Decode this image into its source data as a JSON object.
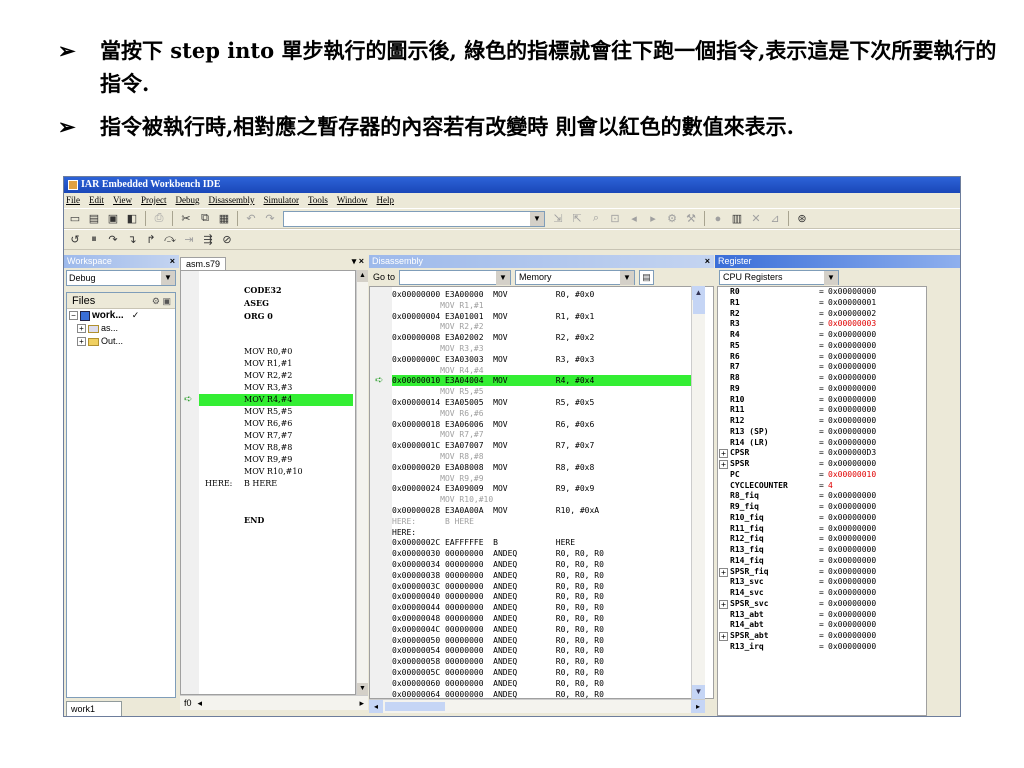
{
  "slide": {
    "bullets": [
      "當按下 step into 單步執行的圖示後, 綠色的指標就會往下跑一個指令,表示這是下次所要執行的指令.",
      "指令被執行時,相對應之暫存器的內容若有改變時 則會以紅色的數值來表示."
    ],
    "bullet_marker": "➢"
  },
  "window": {
    "title": "IAR Embedded Workbench IDE",
    "menu": [
      "File",
      "Edit",
      "View",
      "Project",
      "Debug",
      "Disassembly",
      "Simulator",
      "Tools",
      "Window",
      "Help"
    ]
  },
  "workspace": {
    "title": "Workspace",
    "config": "Debug",
    "tree_header": "Files",
    "tree": [
      {
        "label": "work...",
        "check": "✓"
      },
      {
        "label": "as..."
      },
      {
        "label": "Out..."
      }
    ],
    "tab": "work1"
  },
  "editor": {
    "tab": "asm.s79",
    "lines": [
      {
        "code": "CODE32",
        "bold": true
      },
      {
        "code": "ASEG",
        "bold": true
      },
      {
        "code": "ORG 0",
        "bold": true
      },
      {
        "code": "MOV R0,#0"
      },
      {
        "code": "MOV R1,#1"
      },
      {
        "code": "MOV R2,#2"
      },
      {
        "code": "MOV R3,#3"
      },
      {
        "code": "MOV R4,#4",
        "current": true
      },
      {
        "code": "MOV R5,#5"
      },
      {
        "code": "MOV R6,#6"
      },
      {
        "code": "MOV R7,#7"
      },
      {
        "code": "MOV R8,#8"
      },
      {
        "code": "MOV R9,#9"
      },
      {
        "code": "MOV R10,#10"
      },
      {
        "code": "B HERE",
        "label": "HERE:"
      },
      {
        "code": "END",
        "bold": true
      }
    ],
    "bottom_tab": "f0"
  },
  "disassembly": {
    "title": "Disassembly",
    "goto_label": "Go to",
    "memory_label": "Memory",
    "lines": [
      {
        "t": "0x00000000 E3A00000  MOV          R0, #0x0"
      },
      {
        "t": "          MOV R1,#1",
        "src": true
      },
      {
        "t": "0x00000004 E3A01001  MOV          R1, #0x1"
      },
      {
        "t": "          MOV R2,#2",
        "src": true
      },
      {
        "t": "0x00000008 E3A02002  MOV          R2, #0x2"
      },
      {
        "t": "          MOV R3,#3",
        "src": true
      },
      {
        "t": "0x0000000C E3A03003  MOV          R3, #0x3"
      },
      {
        "t": "          MOV R4,#4",
        "src": true
      },
      {
        "t": "0x00000010 E3A04004  MOV          R4, #0x4",
        "cur": true
      },
      {
        "t": "          MOV R5,#5",
        "src": true
      },
      {
        "t": "0x00000014 E3A05005  MOV          R5, #0x5"
      },
      {
        "t": "          MOV R6,#6",
        "src": true
      },
      {
        "t": "0x00000018 E3A06006  MOV          R6, #0x6"
      },
      {
        "t": "          MOV R7,#7",
        "src": true
      },
      {
        "t": "0x0000001C E3A07007  MOV          R7, #0x7"
      },
      {
        "t": "          MOV R8,#8",
        "src": true
      },
      {
        "t": "0x00000020 E3A08008  MOV          R8, #0x8"
      },
      {
        "t": "          MOV R9,#9",
        "src": true
      },
      {
        "t": "0x00000024 E3A09009  MOV          R9, #0x9"
      },
      {
        "t": "          MOV R10,#10",
        "src": true
      },
      {
        "t": "0x00000028 E3A0A00A  MOV          R10, #0xA"
      },
      {
        "t": "HERE:      B HERE",
        "src": true
      },
      {
        "t": "HERE:"
      },
      {
        "t": "0x0000002C EAFFFFFE  B            HERE"
      },
      {
        "t": "0x00000030 00000000  ANDEQ        R0, R0, R0"
      },
      {
        "t": "0x00000034 00000000  ANDEQ        R0, R0, R0"
      },
      {
        "t": "0x00000038 00000000  ANDEQ        R0, R0, R0"
      },
      {
        "t": "0x0000003C 00000000  ANDEQ        R0, R0, R0"
      },
      {
        "t": "0x00000040 00000000  ANDEQ        R0, R0, R0"
      },
      {
        "t": "0x00000044 00000000  ANDEQ        R0, R0, R0"
      },
      {
        "t": "0x00000048 00000000  ANDEQ        R0, R0, R0"
      },
      {
        "t": "0x0000004C 00000000  ANDEQ        R0, R0, R0"
      },
      {
        "t": "0x00000050 00000000  ANDEQ        R0, R0, R0"
      },
      {
        "t": "0x00000054 00000000  ANDEQ        R0, R0, R0"
      },
      {
        "t": "0x00000058 00000000  ANDEQ        R0, R0, R0"
      },
      {
        "t": "0x0000005C 00000000  ANDEQ        R0, R0, R0"
      },
      {
        "t": "0x00000060 00000000  ANDEQ        R0, R0, R0"
      },
      {
        "t": "0x00000064 00000000  ANDEQ        R0, R0, R0"
      }
    ]
  },
  "registers": {
    "title": "Register",
    "view": "CPU Registers",
    "rows": [
      {
        "name": "R0",
        "value": "0x00000000"
      },
      {
        "name": "R1",
        "value": "0x00000001"
      },
      {
        "name": "R2",
        "value": "0x00000002"
      },
      {
        "name": "R3",
        "value": "0x00000003",
        "changed": true
      },
      {
        "name": "R4",
        "value": "0x00000000"
      },
      {
        "name": "R5",
        "value": "0x00000000"
      },
      {
        "name": "R6",
        "value": "0x00000000"
      },
      {
        "name": "R7",
        "value": "0x00000000"
      },
      {
        "name": "R8",
        "value": "0x00000000"
      },
      {
        "name": "R9",
        "value": "0x00000000"
      },
      {
        "name": "R10",
        "value": "0x00000000"
      },
      {
        "name": "R11",
        "value": "0x00000000"
      },
      {
        "name": "R12",
        "value": "0x00000000"
      },
      {
        "name": "R13 (SP)",
        "value": "0x00000000"
      },
      {
        "name": "R14 (LR)",
        "value": "0x00000000"
      },
      {
        "name": "CPSR",
        "value": "0x000000D3",
        "expand": true
      },
      {
        "name": "SPSR",
        "value": "0x00000000",
        "expand": true
      },
      {
        "name": "PC",
        "value": "0x00000010",
        "changed": true
      },
      {
        "name": "CYCLECOUNTER",
        "value": "4",
        "changed": true
      },
      {
        "name": "R8_fiq",
        "value": "0x00000000"
      },
      {
        "name": "R9_fiq",
        "value": "0x00000000"
      },
      {
        "name": "R10_fiq",
        "value": "0x00000000"
      },
      {
        "name": "R11_fiq",
        "value": "0x00000000"
      },
      {
        "name": "R12_fiq",
        "value": "0x00000000"
      },
      {
        "name": "R13_fiq",
        "value": "0x00000000"
      },
      {
        "name": "R14_fiq",
        "value": "0x00000000"
      },
      {
        "name": "SPSR_fiq",
        "value": "0x00000000",
        "expand": true
      },
      {
        "name": "R13_svc",
        "value": "0x00000000"
      },
      {
        "name": "R14_svc",
        "value": "0x00000000"
      },
      {
        "name": "SPSR_svc",
        "value": "0x00000000",
        "expand": true
      },
      {
        "name": "R13_abt",
        "value": "0x00000000"
      },
      {
        "name": "R14_abt",
        "value": "0x00000000"
      },
      {
        "name": "SPSR_abt",
        "value": "0x00000000",
        "expand": true
      },
      {
        "name": "R13_irq",
        "value": "0x00000000"
      }
    ]
  },
  "colors": {
    "current_line": "#33ee33",
    "changed_value": "#e00000",
    "title_bar": "#2d63d8"
  }
}
